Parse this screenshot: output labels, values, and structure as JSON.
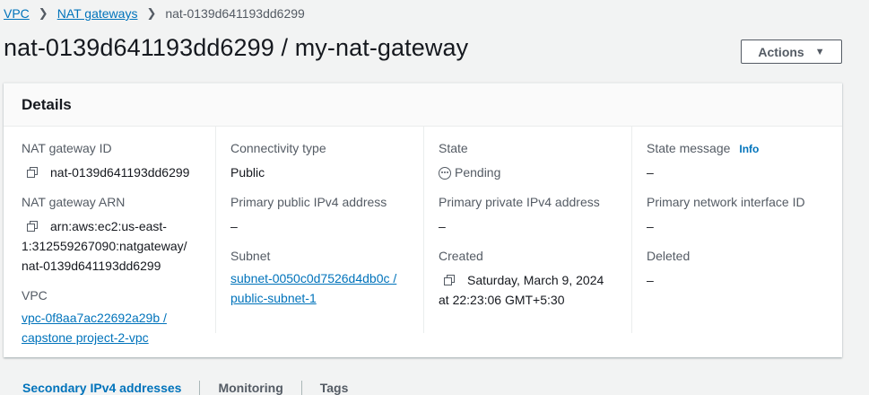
{
  "breadcrumb": {
    "items": [
      "VPC",
      "NAT gateways"
    ],
    "current": "nat-0139d641193dd6299"
  },
  "page_title": "nat-0139d641193dd6299 / my-nat-gateway",
  "actions_label": "Actions",
  "details": {
    "heading": "Details",
    "nat_gateway_id": {
      "label": "NAT gateway ID",
      "value": "nat-0139d641193dd6299"
    },
    "nat_gateway_arn": {
      "label": "NAT gateway ARN",
      "line1": "arn:aws:ec2:us-east-",
      "line2": "1:312559267090:natgateway/",
      "line3": "nat-0139d641193dd6299"
    },
    "vpc": {
      "label": "VPC",
      "line1": "vpc-0f8aa7ac22692a29b /",
      "line2": "capstone project-2-vpc"
    },
    "connectivity_type": {
      "label": "Connectivity type",
      "value": "Public"
    },
    "primary_public_ipv4": {
      "label": "Primary public IPv4 address",
      "value": "–"
    },
    "subnet": {
      "label": "Subnet",
      "line1": "subnet-0050c0d7526d4db0c /",
      "line2": "public-subnet-1"
    },
    "state": {
      "label": "State",
      "value": "Pending"
    },
    "primary_private_ipv4": {
      "label": "Primary private IPv4 address",
      "value": "–"
    },
    "created": {
      "label": "Created",
      "line1": "Saturday, March 9, 2024",
      "line2": "at 22:23:06 GMT+5:30"
    },
    "state_message": {
      "label": "State message",
      "info": "Info",
      "value": "–"
    },
    "primary_network_interface": {
      "label": "Primary network interface ID",
      "value": "–"
    },
    "deleted": {
      "label": "Deleted",
      "value": "–"
    }
  },
  "tabs": [
    "Secondary IPv4 addresses",
    "Monitoring",
    "Tags"
  ],
  "colors": {
    "link": "#0073bb",
    "text": "#16191f",
    "label": "#545b64",
    "background": "#f2f3f3"
  }
}
